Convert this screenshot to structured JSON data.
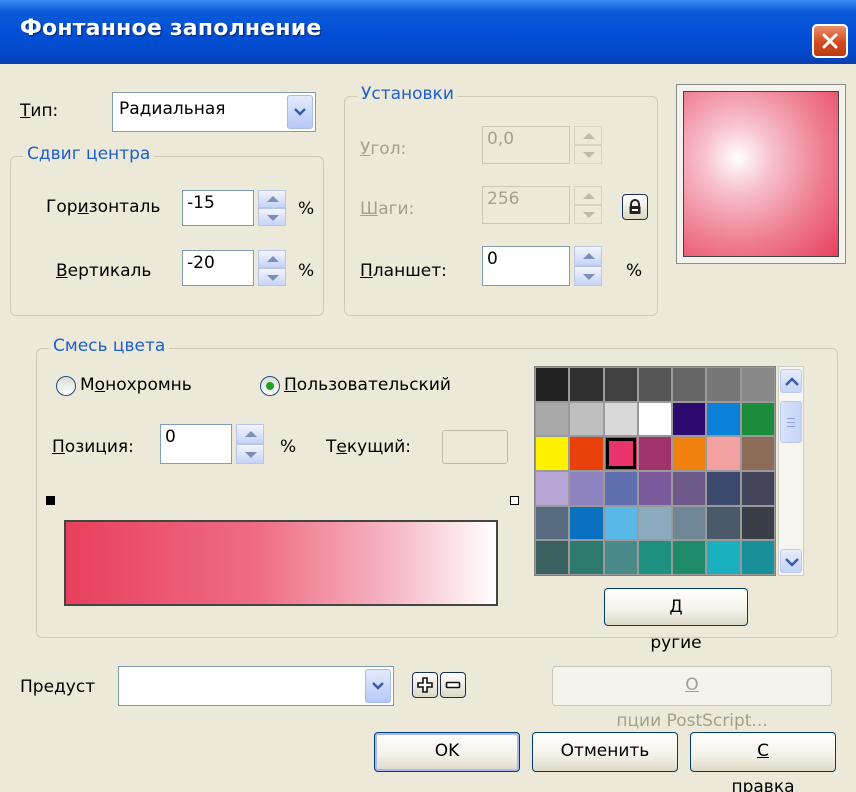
{
  "window": {
    "title": "Фонтанное заполнение",
    "close_icon": "close-icon"
  },
  "type_row": {
    "label": "Тип:",
    "label_underline": "Т",
    "label_rest": "ип:",
    "value": "Радиальная"
  },
  "center_offset": {
    "title": "Сдвиг центра",
    "horizontal": {
      "label_pre": "Гор",
      "label_u": "и",
      "label_post": "зонталь",
      "value": "-15",
      "unit": "%"
    },
    "vertical": {
      "label_u": "В",
      "label_post": "ертикаль",
      "value": "-20",
      "unit": "%"
    }
  },
  "settings": {
    "title": "Установки",
    "angle": {
      "label_u": "У",
      "label_post": "гол:",
      "value": "0,0"
    },
    "steps": {
      "label_u": "Ш",
      "label_post": "аги:",
      "value": "256"
    },
    "pad": {
      "label_u": "П",
      "label_post": "ланшет:",
      "value": "0",
      "unit": "%"
    }
  },
  "color_blend": {
    "title": "Смесь цвета",
    "mono": {
      "label_pre": "М",
      "label_u": "о",
      "label_post": "нохромнь",
      "selected": false
    },
    "custom": {
      "label_u": "П",
      "label_post": "ользовательский",
      "selected": true
    },
    "position": {
      "label_u": "П",
      "label_post": "озиция:",
      "value": "0",
      "unit": "%"
    },
    "current": {
      "label_pre": "Т",
      "label_u": "е",
      "label_post": "кущий:"
    },
    "gradient": {
      "start": "#e8405c",
      "end": "#ffffff"
    },
    "palette": [
      [
        "#222222",
        "#303030",
        "#404040",
        "#555555",
        "#666666",
        "#777777",
        "#888888"
      ],
      [
        "#a9a9a9",
        "#bfbfbf",
        "#d9d9d9",
        "#ffffff",
        "#2c0a6f",
        "#0b80d8",
        "#1a8c3c"
      ],
      [
        "#fff200",
        "#e8420a",
        "#e8336b",
        "#a0336b",
        "#f08010",
        "#f2a0a0",
        "#8c6c58"
      ],
      [
        "#b5a6d6",
        "#8f83bf",
        "#5f6fb0",
        "#7a5a9a",
        "#6e5a8a",
        "#3c4a70",
        "#44445a"
      ],
      [
        "#566a80",
        "#0a70c0",
        "#58b8e8",
        "#8aaabe",
        "#6e8696",
        "#4a5a68",
        "#3a3e48"
      ],
      [
        "#3a6060",
        "#2e7a6e",
        "#4a8a8a",
        "#1e9080",
        "#1e8c6c",
        "#1ab0c0",
        "#18909a"
      ]
    ],
    "selected_swatch": "2,2",
    "others_button": {
      "label_u": "Д",
      "label_post": "ругие"
    }
  },
  "presets": {
    "label": "Предуст",
    "value": "",
    "add_icon": "plus-icon",
    "remove_icon": "minus-icon"
  },
  "postscript_button": {
    "label_u": "О",
    "label_post": "пции PostScript..."
  },
  "buttons": {
    "ok": "OK",
    "cancel": "Отменить",
    "help_u": "С",
    "help_post": "правка"
  },
  "colors": {
    "accent": "#1d5fd0",
    "title_bar": "#0350d6",
    "face": "#ece9d8"
  }
}
